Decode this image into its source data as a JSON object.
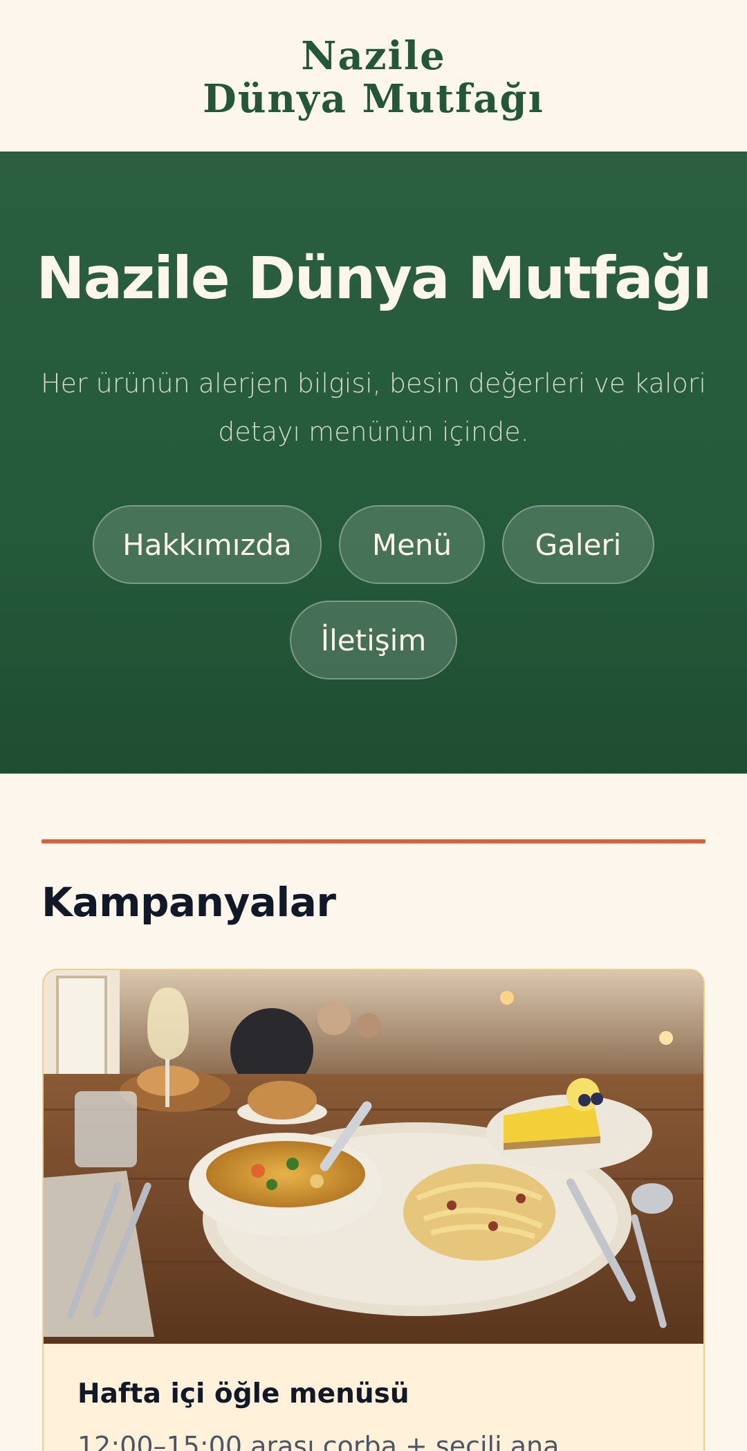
{
  "header": {
    "logo_line1": "Nazile",
    "logo_line2": "Dünya Mutfağı"
  },
  "hero": {
    "title": "Nazile Dünya Mutfağı",
    "subtitle": "Her ürünün alerjen bilgisi, besin değerleri ve kalori detayı menünün içinde.",
    "nav": [
      "Hakkımızda",
      "Menü",
      "Galeri",
      "İletişim"
    ]
  },
  "campaigns": {
    "section_title": "Kampanyalar",
    "cards": [
      {
        "title": "Hafta içi öğle menüsü",
        "description": "12:00–15:00 arası çorba + seçili ana"
      }
    ]
  },
  "colors": {
    "brand_green": "#24563a",
    "cream": "#fdf6ec",
    "accent": "#d9623c",
    "card_border": "#f0cf8a"
  }
}
